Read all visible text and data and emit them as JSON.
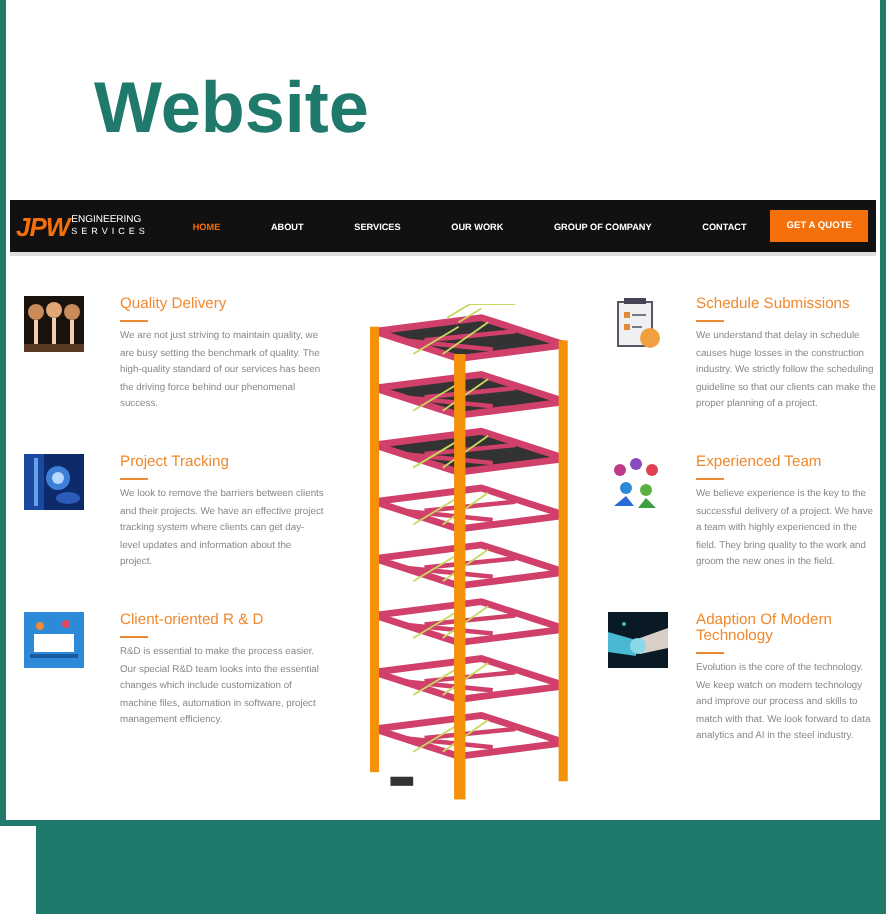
{
  "title": "Website",
  "site": {
    "logo": {
      "mark": "JPW",
      "line1": "ENGINEERING",
      "line2": "SERVICES"
    },
    "nav": [
      {
        "label": "HOME",
        "selected": true
      },
      {
        "label": "ABOUT",
        "selected": false
      },
      {
        "label": "SERVICES",
        "selected": false
      },
      {
        "label": "OUR WORK",
        "selected": false
      },
      {
        "label": "GROUP OF COMPANY",
        "selected": false
      },
      {
        "label": "CONTACT",
        "selected": false
      }
    ],
    "cta": "GET A QUOTE",
    "left_features": [
      {
        "kind": "bulbs",
        "title": "Quality Delivery",
        "text": "We are not just striving to maintain quality, we are busy setting the benchmark of quality. The high-quality standard of our services has been the driving force behind our phenomenal success."
      },
      {
        "kind": "tracking",
        "title": "Project Tracking",
        "text": "We look to remove the barriers between clients and their projects. We have an effective project tracking system where clients can get day-level updates and information about the project."
      },
      {
        "kind": "rnd",
        "title": "Client-oriented R & D",
        "text": "R&D is essential to make the process easier. Our special R&D team looks into the essential changes which include customization of machine files, automation in software, project management efficiency."
      }
    ],
    "right_features": [
      {
        "kind": "schedule",
        "title": "Schedule Submissions",
        "text": "We understand that delay in schedule causes huge losses in the construction industry. We strictly follow the scheduling guideline so that our clients can make the proper planning of a project."
      },
      {
        "kind": "team",
        "title": "Experienced Team",
        "text": "We believe experience is the key to the successful delivery of a project. We have a team with highly experienced in the field. They bring quality to the work and groom the new ones in the field."
      },
      {
        "kind": "handshake",
        "title": "Adaption Of Modern Technology",
        "text": "Evolution is the core of the technology. We keep watch on modern technology and improve our process and skills to match with that. We look forward to data analytics and AI in the steel industry."
      }
    ]
  }
}
